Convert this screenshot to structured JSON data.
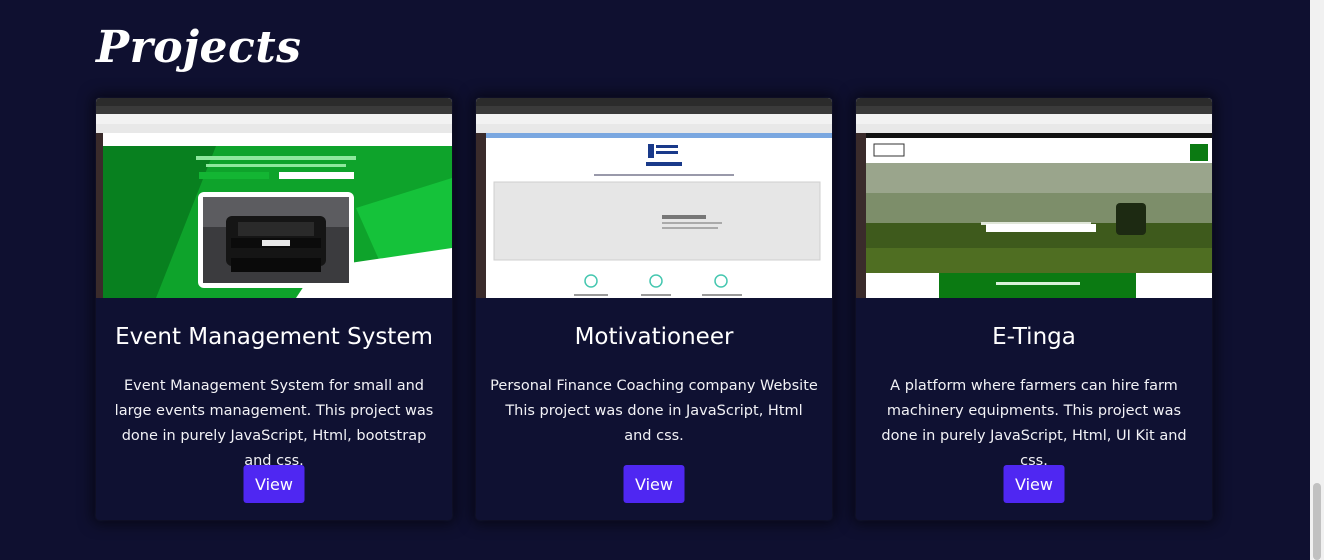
{
  "section": {
    "title": "Projects"
  },
  "projects": [
    {
      "title": "Event Management System",
      "description": "Event Management System for small and large events management. This project was done in purely JavaScript, Html, bootstrap and css.",
      "button": "View"
    },
    {
      "title": "Motivationeer",
      "description": "Personal Finance Coaching company Website This project was done in JavaScript, Html and css.",
      "button": "View"
    },
    {
      "title": "E-Tinga",
      "description": "A platform where farmers can hire farm machinery equipments. This project was done in purely JavaScript, Html, UI Kit and css.",
      "button": "View"
    }
  ],
  "screenshots": {
    "motivationeer": {
      "brand": "Prystles Insights",
      "brand_sub": "COACHING",
      "hero_text": "Coach & Mentor"
    },
    "etinga": {
      "logo": "LOGO",
      "hero_line1": "YOUR ONE-STOP SOURCE FOR ALL EQUIPMENT",
      "hero_line2": "RENTAL NEEDS",
      "cta": "~ Find The Right Equipment ~"
    },
    "event": {
      "car_plate": "RoCars"
    }
  },
  "colors": {
    "background": "#0f1030",
    "button": "#4f27f2",
    "event_green": "#10a32a",
    "etinga_green": "#0b7a12"
  }
}
